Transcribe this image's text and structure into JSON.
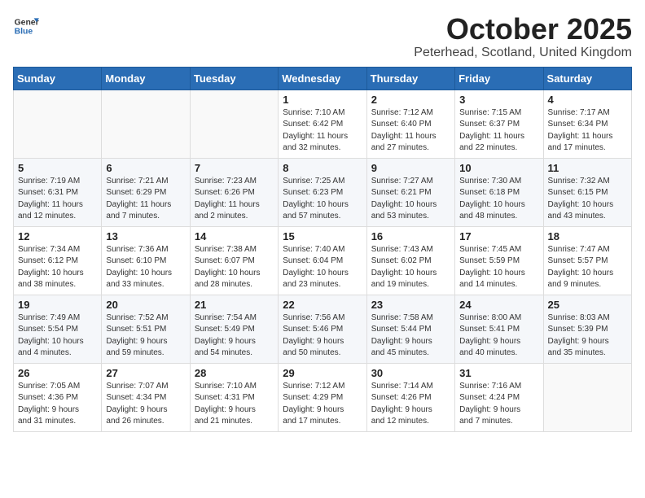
{
  "logo": {
    "general": "General",
    "blue": "Blue"
  },
  "title": "October 2025",
  "subtitle": "Peterhead, Scotland, United Kingdom",
  "days_of_week": [
    "Sunday",
    "Monday",
    "Tuesday",
    "Wednesday",
    "Thursday",
    "Friday",
    "Saturday"
  ],
  "weeks": [
    [
      {
        "day": "",
        "info": ""
      },
      {
        "day": "",
        "info": ""
      },
      {
        "day": "",
        "info": ""
      },
      {
        "day": "1",
        "info": "Sunrise: 7:10 AM\nSunset: 6:42 PM\nDaylight: 11 hours\nand 32 minutes."
      },
      {
        "day": "2",
        "info": "Sunrise: 7:12 AM\nSunset: 6:40 PM\nDaylight: 11 hours\nand 27 minutes."
      },
      {
        "day": "3",
        "info": "Sunrise: 7:15 AM\nSunset: 6:37 PM\nDaylight: 11 hours\nand 22 minutes."
      },
      {
        "day": "4",
        "info": "Sunrise: 7:17 AM\nSunset: 6:34 PM\nDaylight: 11 hours\nand 17 minutes."
      }
    ],
    [
      {
        "day": "5",
        "info": "Sunrise: 7:19 AM\nSunset: 6:31 PM\nDaylight: 11 hours\nand 12 minutes."
      },
      {
        "day": "6",
        "info": "Sunrise: 7:21 AM\nSunset: 6:29 PM\nDaylight: 11 hours\nand 7 minutes."
      },
      {
        "day": "7",
        "info": "Sunrise: 7:23 AM\nSunset: 6:26 PM\nDaylight: 11 hours\nand 2 minutes."
      },
      {
        "day": "8",
        "info": "Sunrise: 7:25 AM\nSunset: 6:23 PM\nDaylight: 10 hours\nand 57 minutes."
      },
      {
        "day": "9",
        "info": "Sunrise: 7:27 AM\nSunset: 6:21 PM\nDaylight: 10 hours\nand 53 minutes."
      },
      {
        "day": "10",
        "info": "Sunrise: 7:30 AM\nSunset: 6:18 PM\nDaylight: 10 hours\nand 48 minutes."
      },
      {
        "day": "11",
        "info": "Sunrise: 7:32 AM\nSunset: 6:15 PM\nDaylight: 10 hours\nand 43 minutes."
      }
    ],
    [
      {
        "day": "12",
        "info": "Sunrise: 7:34 AM\nSunset: 6:12 PM\nDaylight: 10 hours\nand 38 minutes."
      },
      {
        "day": "13",
        "info": "Sunrise: 7:36 AM\nSunset: 6:10 PM\nDaylight: 10 hours\nand 33 minutes."
      },
      {
        "day": "14",
        "info": "Sunrise: 7:38 AM\nSunset: 6:07 PM\nDaylight: 10 hours\nand 28 minutes."
      },
      {
        "day": "15",
        "info": "Sunrise: 7:40 AM\nSunset: 6:04 PM\nDaylight: 10 hours\nand 23 minutes."
      },
      {
        "day": "16",
        "info": "Sunrise: 7:43 AM\nSunset: 6:02 PM\nDaylight: 10 hours\nand 19 minutes."
      },
      {
        "day": "17",
        "info": "Sunrise: 7:45 AM\nSunset: 5:59 PM\nDaylight: 10 hours\nand 14 minutes."
      },
      {
        "day": "18",
        "info": "Sunrise: 7:47 AM\nSunset: 5:57 PM\nDaylight: 10 hours\nand 9 minutes."
      }
    ],
    [
      {
        "day": "19",
        "info": "Sunrise: 7:49 AM\nSunset: 5:54 PM\nDaylight: 10 hours\nand 4 minutes."
      },
      {
        "day": "20",
        "info": "Sunrise: 7:52 AM\nSunset: 5:51 PM\nDaylight: 9 hours\nand 59 minutes."
      },
      {
        "day": "21",
        "info": "Sunrise: 7:54 AM\nSunset: 5:49 PM\nDaylight: 9 hours\nand 54 minutes."
      },
      {
        "day": "22",
        "info": "Sunrise: 7:56 AM\nSunset: 5:46 PM\nDaylight: 9 hours\nand 50 minutes."
      },
      {
        "day": "23",
        "info": "Sunrise: 7:58 AM\nSunset: 5:44 PM\nDaylight: 9 hours\nand 45 minutes."
      },
      {
        "day": "24",
        "info": "Sunrise: 8:00 AM\nSunset: 5:41 PM\nDaylight: 9 hours\nand 40 minutes."
      },
      {
        "day": "25",
        "info": "Sunrise: 8:03 AM\nSunset: 5:39 PM\nDaylight: 9 hours\nand 35 minutes."
      }
    ],
    [
      {
        "day": "26",
        "info": "Sunrise: 7:05 AM\nSunset: 4:36 PM\nDaylight: 9 hours\nand 31 minutes."
      },
      {
        "day": "27",
        "info": "Sunrise: 7:07 AM\nSunset: 4:34 PM\nDaylight: 9 hours\nand 26 minutes."
      },
      {
        "day": "28",
        "info": "Sunrise: 7:10 AM\nSunset: 4:31 PM\nDaylight: 9 hours\nand 21 minutes."
      },
      {
        "day": "29",
        "info": "Sunrise: 7:12 AM\nSunset: 4:29 PM\nDaylight: 9 hours\nand 17 minutes."
      },
      {
        "day": "30",
        "info": "Sunrise: 7:14 AM\nSunset: 4:26 PM\nDaylight: 9 hours\nand 12 minutes."
      },
      {
        "day": "31",
        "info": "Sunrise: 7:16 AM\nSunset: 4:24 PM\nDaylight: 9 hours\nand 7 minutes."
      },
      {
        "day": "",
        "info": ""
      }
    ]
  ]
}
